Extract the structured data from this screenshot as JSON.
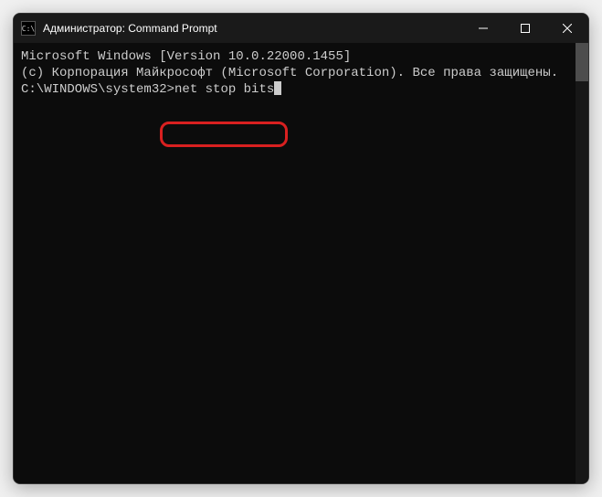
{
  "titlebar": {
    "title": "Администратор: Command Prompt"
  },
  "console": {
    "line1": "Microsoft Windows [Version 10.0.22000.1455]",
    "line2": "(c) Корпорация Майкрософт (Microsoft Corporation). Все права защищены.",
    "blank": "",
    "prompt": "C:\\WINDOWS\\system32>",
    "command": "net stop bits"
  }
}
